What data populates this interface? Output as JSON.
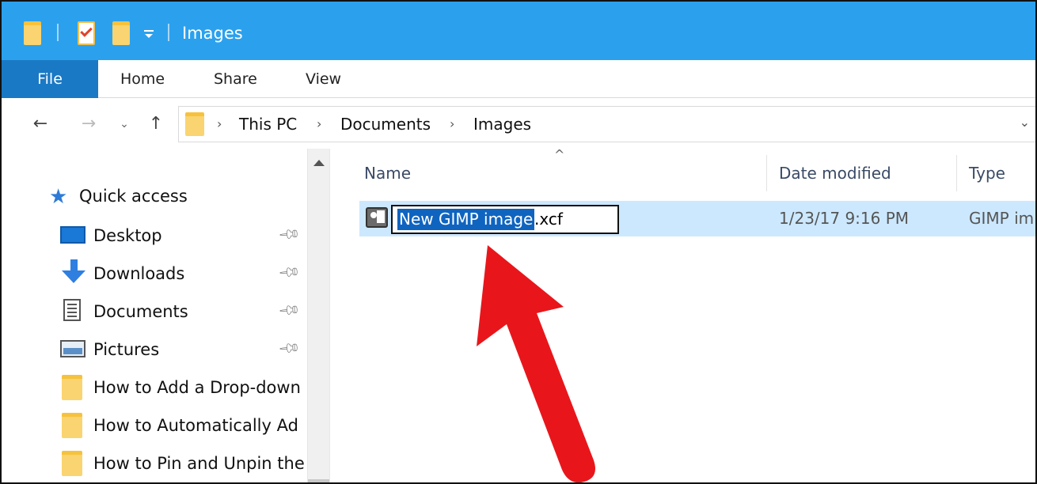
{
  "window": {
    "title": "Images",
    "accent_color": "#2ba1ee",
    "quick_access_toolbar": [
      "folder-icon",
      "properties-icon",
      "new-folder-icon",
      "customize-dropdown-icon"
    ]
  },
  "ribbon": {
    "tabs": [
      {
        "label": "File",
        "active": true
      },
      {
        "label": "Home"
      },
      {
        "label": "Share"
      },
      {
        "label": "View"
      }
    ]
  },
  "navigation": {
    "back": "←",
    "forward": "→",
    "recent": "⌄",
    "up": "↑"
  },
  "address": {
    "crumbs": [
      "This PC",
      "Documents",
      "Images"
    ],
    "separator": "›",
    "dropdown": "⌄"
  },
  "nav_pane": {
    "quick_access_label": "Quick access",
    "items": [
      {
        "label": "Desktop",
        "icon": "desktop-icon",
        "pinned": true
      },
      {
        "label": "Downloads",
        "icon": "downloads-icon",
        "pinned": true
      },
      {
        "label": "Documents",
        "icon": "documents-icon",
        "pinned": true
      },
      {
        "label": "Pictures",
        "icon": "pictures-icon",
        "pinned": true
      },
      {
        "label": "How to Add a Drop-down",
        "icon": "folder-icon",
        "pinned": false
      },
      {
        "label": "How to Automatically Ad",
        "icon": "folder-icon",
        "pinned": false
      },
      {
        "label": "How to Pin and Unpin the",
        "icon": "folder-icon",
        "pinned": false
      }
    ]
  },
  "file_list": {
    "columns": [
      "Name",
      "Date modified",
      "Type"
    ],
    "sort_indicator": "^",
    "rows": [
      {
        "name_selected": "New GIMP image",
        "name_extension": ".xcf",
        "date_modified": "1/23/17 9:16 PM",
        "type": "GIMP im",
        "renaming": true
      }
    ]
  },
  "annotation": {
    "arrow_color": "#e8161b",
    "points_to": "rename-box"
  }
}
